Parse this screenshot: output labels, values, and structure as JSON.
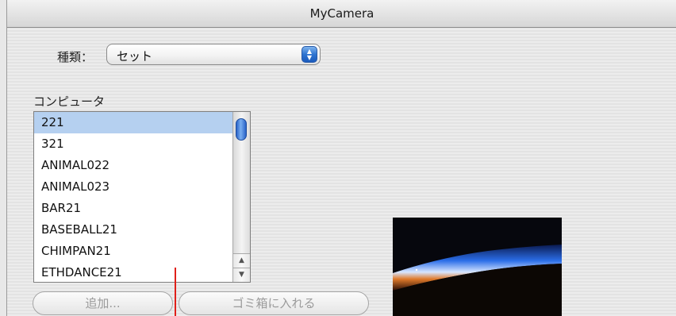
{
  "window": {
    "title": "MyCamera"
  },
  "kind": {
    "label": "種類：",
    "selected": "セット"
  },
  "computer": {
    "label": "コンピュータ",
    "items": [
      {
        "label": "221",
        "selected": true
      },
      {
        "label": "321",
        "selected": false
      },
      {
        "label": "ANIMAL022",
        "selected": false
      },
      {
        "label": "ANIMAL023",
        "selected": false
      },
      {
        "label": "BAR21",
        "selected": false
      },
      {
        "label": "BASEBALL21",
        "selected": false
      },
      {
        "label": "CHIMPAN21",
        "selected": false
      },
      {
        "label": "ETHDANCE21",
        "selected": false
      }
    ]
  },
  "buttons": {
    "add_label": "追加...",
    "trash_label": "ゴミ箱に入れる"
  },
  "colors": {
    "selection": "#b5d0f0",
    "accent_blue": "#2f74d0",
    "cursor_red": "#e0201a"
  },
  "icons": {
    "popup": "up-down-arrows-icon",
    "scroll_up": "scroll-up-arrow-icon",
    "scroll_down": "scroll-down-arrow-icon"
  }
}
